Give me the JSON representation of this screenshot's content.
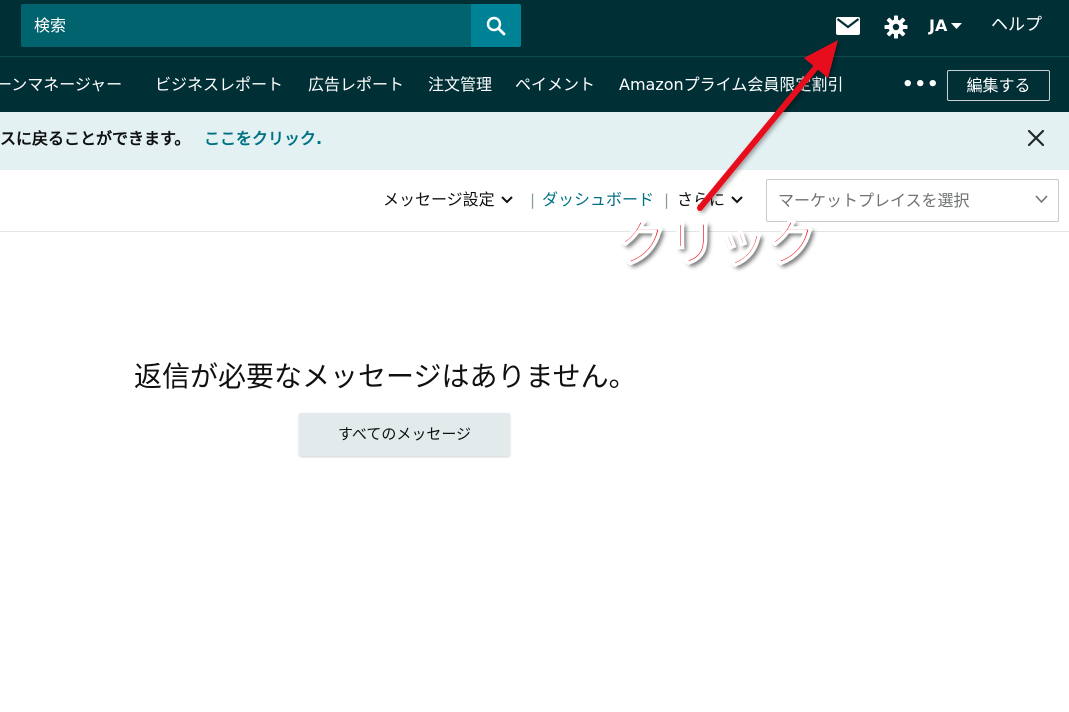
{
  "header": {
    "search_placeholder": "検索",
    "language": "JA",
    "help_label": "ヘルプ"
  },
  "nav": {
    "items": [
      "ーンマネージャー",
      "ビジネスレポート",
      "広告レポート",
      "注文管理",
      "ペイメント",
      "Amazonプライム会員限定割引"
    ],
    "more_label": "•••",
    "edit_label": "編集する"
  },
  "banner": {
    "text": "スに戻ることができます。",
    "link_text": "ここをクリック",
    "link_suffix": "."
  },
  "toolbar": {
    "message_settings": "メッセージ設定",
    "separator": "|",
    "dashboard": "ダッシュボード",
    "more": "さらに",
    "marketplace_placeholder": "マーケットプレイスを選択"
  },
  "main": {
    "empty_message": "返信が必要なメッセージはありません。",
    "all_messages_button": "すべてのメッセージ"
  },
  "annotation": {
    "label": "クリック",
    "color": "#e8111c"
  },
  "colors": {
    "header_bg": "#002f36",
    "search_bg": "#00636d",
    "search_button": "#008296",
    "banner_bg": "#e3f1f3",
    "link": "#007185"
  },
  "icons": {
    "search": "search-icon",
    "mail": "mail-icon",
    "settings": "gear-icon",
    "close": "close-icon"
  }
}
